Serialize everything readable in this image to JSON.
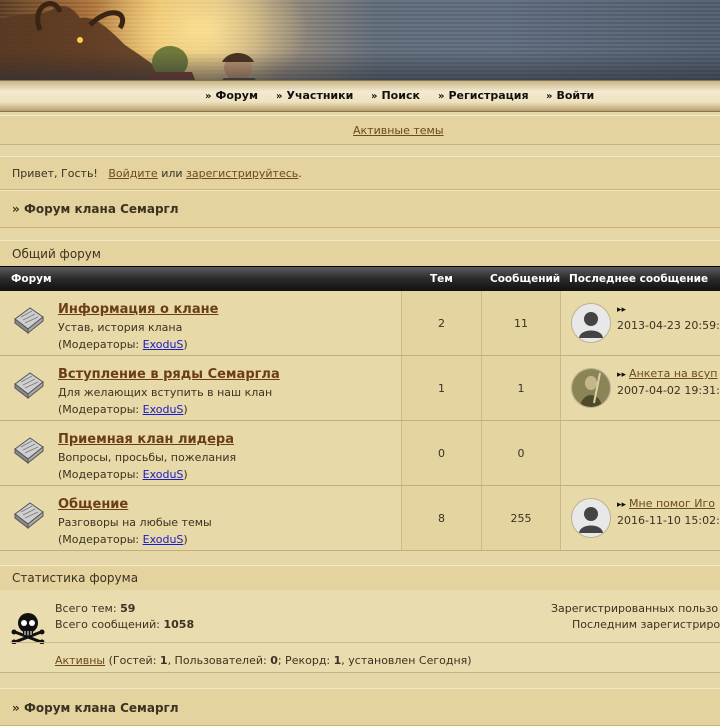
{
  "nav": {
    "items": [
      {
        "label": "Форум"
      },
      {
        "label": "Участники"
      },
      {
        "label": "Поиск"
      },
      {
        "label": "Регистрация"
      },
      {
        "label": "Войти"
      }
    ]
  },
  "active_topics_link": "Активные темы",
  "welcome": {
    "greeting": "Привет, Гость!",
    "login_link": "Войдите",
    "or": "или",
    "register_link": "зарегистрируйтесь",
    "period": "."
  },
  "breadcrumb": {
    "prefix": "»",
    "title": "Форум клана Семаргл"
  },
  "category": {
    "title": "Общий форум"
  },
  "table": {
    "headers": {
      "forum": "Форум",
      "topics": "Тем",
      "posts": "Сообщений",
      "last": "Последнее сообщение"
    },
    "mods_prefix": "(Модераторы: ",
    "mods_suffix": ")",
    "rows": [
      {
        "title": "Информация о клане",
        "desc": "Устав, история клана",
        "moderator": "ExoduS",
        "topics": "2",
        "posts": "11",
        "last_link": "",
        "last_date": "2013-04-23 20:59:",
        "avatar": "default-avatar"
      },
      {
        "title": "Вступление в ряды Семаргла",
        "desc": "Для желающих вступить в наш клан",
        "moderator": "ExoduS",
        "topics": "1",
        "posts": "1",
        "last_link": "Анкета на всуп",
        "last_date": "2007-04-02 19:31:",
        "avatar": "warrior-avatar"
      },
      {
        "title": "Приемная клан лидера",
        "desc": "Вопросы, просьбы, пожелания",
        "moderator": "ExoduS",
        "topics": "0",
        "posts": "0",
        "last_link": "",
        "last_date": "",
        "avatar": ""
      },
      {
        "title": "Общение",
        "desc": "Разговоры на любые темы",
        "moderator": "ExoduS",
        "topics": "8",
        "posts": "255",
        "last_link": "Мне помог Иго",
        "last_date": "2016-11-10 15:02:",
        "avatar": "default-avatar"
      }
    ]
  },
  "stats": {
    "title": "Статистика форума",
    "total_topics_label": "Всего тем:",
    "total_topics": "59",
    "total_posts_label": "Всего сообщений:",
    "total_posts": "1058",
    "registered_label": "Зарегистрированных пользо",
    "last_registered_label": "Последним зарегистриро",
    "active_link": "Активны",
    "online_guests_label": " (Гостей: ",
    "guests": "1",
    "users_label": ", Пользователей: ",
    "users": "0",
    "record_label": "; Рекорд: ",
    "record": "1",
    "record_suffix": ", установлен Сегодня)"
  },
  "footer_breadcrumb": {
    "prefix": "»",
    "title": "Форум клана Семаргл"
  }
}
